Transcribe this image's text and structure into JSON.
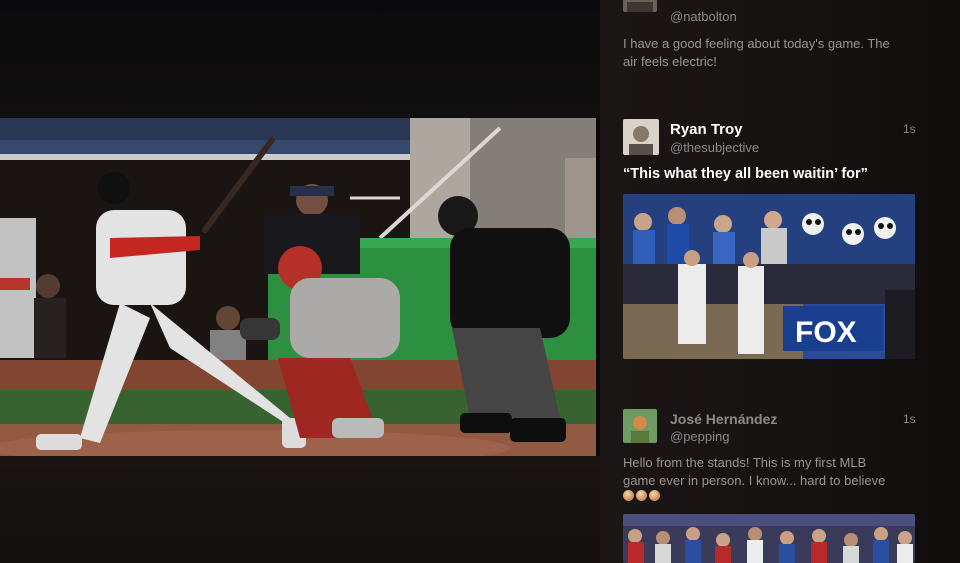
{
  "tweets": [
    {
      "handle": "@natbolton",
      "text": "I have a good feeling about today's game. The air feels electric!",
      "text_line1": "I have a good feeling about today's game. The",
      "text_line2": "air feels electric!"
    },
    {
      "name": "Ryan Troy",
      "handle": "@thesubjective",
      "time": "1s",
      "text": "“This what they all been waitin’ for”",
      "photo_text": "FOX"
    },
    {
      "name": "José Hernández",
      "handle": "@pepping",
      "time": "1s",
      "text_line1": "Hello from the stands! This is my first MLB",
      "text_line2": "game ever in person. I know... hard to believe",
      "emoji": [
        "raised-hands",
        "raised-hands",
        "raised-hands"
      ]
    }
  ],
  "colors": {
    "background": "#0b0909",
    "sidebar": "#161211",
    "name_text": "#ffffff",
    "secondary_text": "#8f8886",
    "fox_blue": "#1b3f8f"
  }
}
